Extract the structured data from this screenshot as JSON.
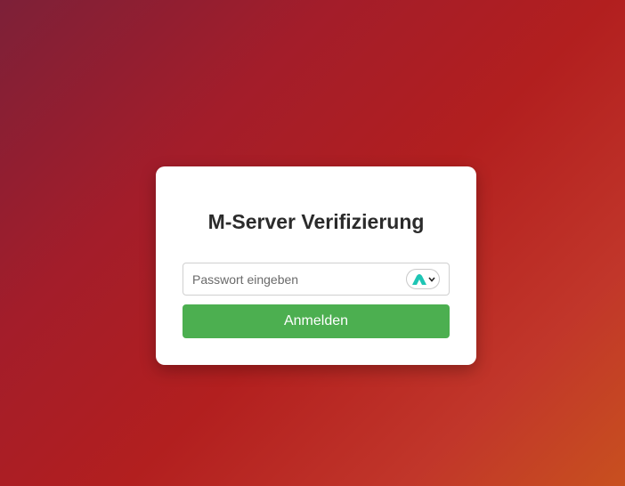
{
  "card": {
    "title": "M-Server Verifizierung"
  },
  "password_field": {
    "placeholder": "Passwort eingeben",
    "value": ""
  },
  "password_manager_widget": {
    "icon": "password-manager-logo-icon",
    "dropdown_icon": "chevron-down-icon",
    "accent_color": "#1ec5b4"
  },
  "login_button": {
    "label": "Anmelden",
    "color": "#4caf50"
  },
  "background": {
    "colors": [
      "#7d2038",
      "#b21f1f",
      "#c8501f"
    ]
  }
}
